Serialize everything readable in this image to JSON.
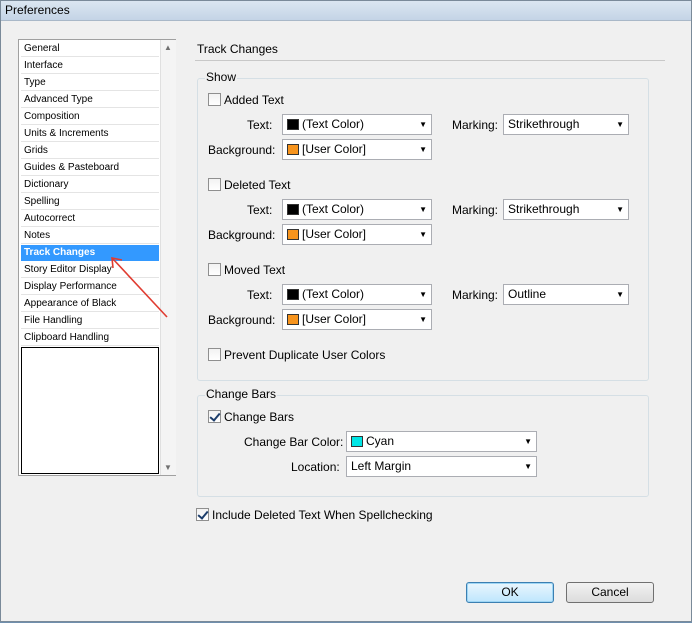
{
  "window": {
    "title": "Preferences"
  },
  "categories": [
    {
      "label": "General"
    },
    {
      "label": "Interface"
    },
    {
      "label": "Type"
    },
    {
      "label": "Advanced Type"
    },
    {
      "label": "Composition"
    },
    {
      "label": "Units & Increments"
    },
    {
      "label": "Grids"
    },
    {
      "label": "Guides & Pasteboard"
    },
    {
      "label": "Dictionary"
    },
    {
      "label": "Spelling"
    },
    {
      "label": "Autocorrect"
    },
    {
      "label": "Notes"
    },
    {
      "label": "Track Changes",
      "selected": true
    },
    {
      "label": "Story Editor Display"
    },
    {
      "label": "Display Performance"
    },
    {
      "label": "Appearance of Black"
    },
    {
      "label": "File Handling"
    },
    {
      "label": "Clipboard Handling"
    }
  ],
  "pane": {
    "title": "Track Changes",
    "show": {
      "label": "Show",
      "text_label": "Text:",
      "background_label": "Background:",
      "marking_label": "Marking:",
      "added": {
        "label": "Added Text",
        "checked": false,
        "text_color": "(Text Color)",
        "text_swatch": "#000000",
        "bg_color": "[User Color]",
        "bg_swatch": "#f7941d",
        "marking": "Strikethrough"
      },
      "deleted": {
        "label": "Deleted Text",
        "checked": false,
        "text_color": "(Text Color)",
        "text_swatch": "#000000",
        "bg_color": "[User Color]",
        "bg_swatch": "#f7941d",
        "marking": "Strikethrough"
      },
      "moved": {
        "label": "Moved Text",
        "checked": false,
        "text_color": "(Text Color)",
        "text_swatch": "#000000",
        "bg_color": "[User Color]",
        "bg_swatch": "#f7941d",
        "marking": "Outline"
      },
      "prevent_duplicate": {
        "label": "Prevent Duplicate User Colors",
        "checked": false
      }
    },
    "change_bars": {
      "label": "Change Bars",
      "enable": {
        "label": "Change Bars",
        "checked": true
      },
      "color_label": "Change Bar Color:",
      "color_value": "Cyan",
      "color_swatch": "#00e5e5",
      "location_label": "Location:",
      "location_value": "Left Margin"
    },
    "include_deleted": {
      "label": "Include Deleted Text When Spellchecking",
      "checked": true
    }
  },
  "buttons": {
    "ok": "OK",
    "cancel": "Cancel"
  },
  "icons": {
    "dropdown": "chevron-down-icon",
    "scroll_up": "scroll-up-arrow-icon",
    "scroll_down": "scroll-down-arrow-icon"
  }
}
